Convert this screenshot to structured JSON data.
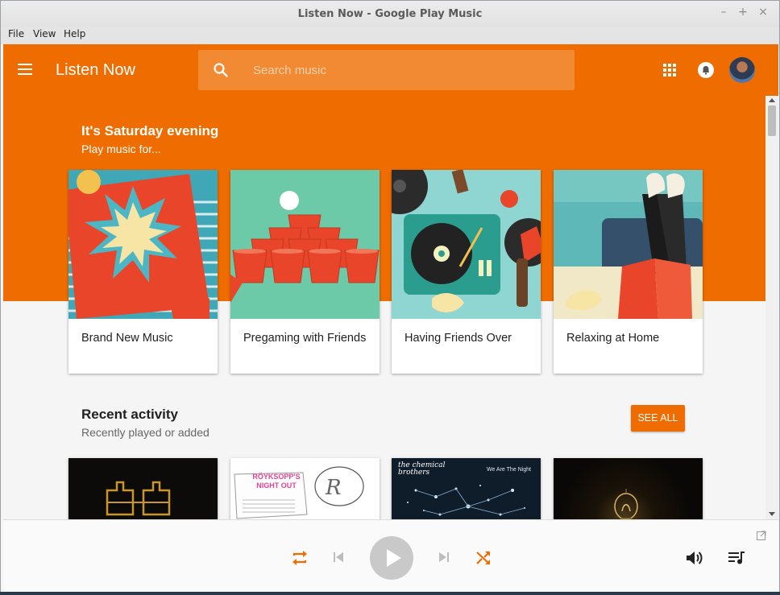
{
  "window": {
    "title": "Listen Now - Google Play Music",
    "controls": [
      "–",
      "+",
      "×"
    ]
  },
  "menubar": {
    "items": [
      "File",
      "View",
      "Help"
    ]
  },
  "appbar": {
    "title": "Listen Now",
    "search_placeholder": "Search music",
    "accent": "#ef6c00"
  },
  "hero": {
    "heading": "It's Saturday evening",
    "subheading": "Play music for...",
    "cards": [
      {
        "label": "Brand New Music"
      },
      {
        "label": "Pregaming with Friends"
      },
      {
        "label": "Having Friends Over"
      },
      {
        "label": "Relaxing at Home"
      }
    ]
  },
  "recent": {
    "heading": "Recent activity",
    "subheading": "Recently played or added",
    "see_all_label": "SEE ALL",
    "albums": [
      {
        "art_text": ""
      },
      {
        "art_text": "RÖYKSOPP'S NIGHT OUT"
      },
      {
        "art_text": "the chemical brothers",
        "art_text_2": "We Are The Night"
      },
      {
        "art_text": ""
      }
    ]
  },
  "player": {
    "controls": [
      "repeat",
      "previous",
      "play",
      "next",
      "shuffle",
      "volume",
      "queue"
    ]
  }
}
